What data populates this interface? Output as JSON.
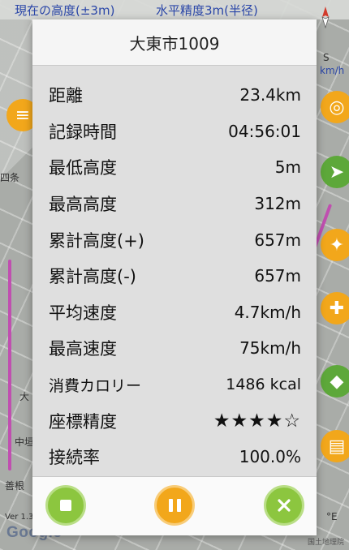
{
  "map": {
    "altitude_label": "現在の高度(±3m)",
    "accuracy_label": "水平精度3m(半径)",
    "version": "Ver 1.3",
    "attribution": "国土地理院",
    "brand": "Google",
    "places": [
      "四条",
      "中垣",
      "大",
      "善根"
    ],
    "right_partial": [
      "S",
      "km/h",
      "園",
      "°E"
    ]
  },
  "dialog": {
    "title": "大東市1009",
    "stats": [
      {
        "label": "距離",
        "value": "23.4km"
      },
      {
        "label": "記録時間",
        "value": "04:56:01"
      },
      {
        "label": "最低高度",
        "value": "5m"
      },
      {
        "label": "最高高度",
        "value": "312m"
      },
      {
        "label": "累計高度(+)",
        "value": "657m"
      },
      {
        "label": "累計高度(-)",
        "value": "657m"
      },
      {
        "label": "平均速度",
        "value": "4.7km/h"
      },
      {
        "label": "最高速度",
        "value": "75km/h"
      },
      {
        "label": "消費カロリー",
        "value": "1486 kcal"
      },
      {
        "label": "座標精度",
        "value": "★★★★☆"
      },
      {
        "label": "接続率",
        "value": "100.0%"
      }
    ]
  },
  "colors": {
    "green_button": "#8cc63f",
    "orange_button": "#f2a71b",
    "map_text": "#2a46a8",
    "route": "#c04fb0"
  },
  "icons": {
    "stop": "stop-icon",
    "pause": "pause-icon",
    "close": "close-icon"
  }
}
